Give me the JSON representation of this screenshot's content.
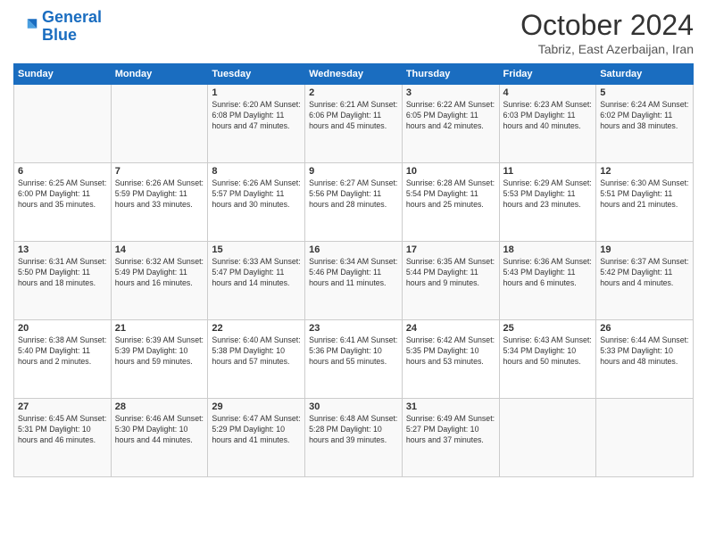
{
  "logo": {
    "line1": "General",
    "line2": "Blue"
  },
  "header": {
    "month": "October 2024",
    "location": "Tabriz, East Azerbaijan, Iran"
  },
  "weekdays": [
    "Sunday",
    "Monday",
    "Tuesday",
    "Wednesday",
    "Thursday",
    "Friday",
    "Saturday"
  ],
  "weeks": [
    [
      {
        "day": "",
        "info": ""
      },
      {
        "day": "",
        "info": ""
      },
      {
        "day": "1",
        "info": "Sunrise: 6:20 AM\nSunset: 6:08 PM\nDaylight: 11 hours and 47 minutes."
      },
      {
        "day": "2",
        "info": "Sunrise: 6:21 AM\nSunset: 6:06 PM\nDaylight: 11 hours and 45 minutes."
      },
      {
        "day": "3",
        "info": "Sunrise: 6:22 AM\nSunset: 6:05 PM\nDaylight: 11 hours and 42 minutes."
      },
      {
        "day": "4",
        "info": "Sunrise: 6:23 AM\nSunset: 6:03 PM\nDaylight: 11 hours and 40 minutes."
      },
      {
        "day": "5",
        "info": "Sunrise: 6:24 AM\nSunset: 6:02 PM\nDaylight: 11 hours and 38 minutes."
      }
    ],
    [
      {
        "day": "6",
        "info": "Sunrise: 6:25 AM\nSunset: 6:00 PM\nDaylight: 11 hours and 35 minutes."
      },
      {
        "day": "7",
        "info": "Sunrise: 6:26 AM\nSunset: 5:59 PM\nDaylight: 11 hours and 33 minutes."
      },
      {
        "day": "8",
        "info": "Sunrise: 6:26 AM\nSunset: 5:57 PM\nDaylight: 11 hours and 30 minutes."
      },
      {
        "day": "9",
        "info": "Sunrise: 6:27 AM\nSunset: 5:56 PM\nDaylight: 11 hours and 28 minutes."
      },
      {
        "day": "10",
        "info": "Sunrise: 6:28 AM\nSunset: 5:54 PM\nDaylight: 11 hours and 25 minutes."
      },
      {
        "day": "11",
        "info": "Sunrise: 6:29 AM\nSunset: 5:53 PM\nDaylight: 11 hours and 23 minutes."
      },
      {
        "day": "12",
        "info": "Sunrise: 6:30 AM\nSunset: 5:51 PM\nDaylight: 11 hours and 21 minutes."
      }
    ],
    [
      {
        "day": "13",
        "info": "Sunrise: 6:31 AM\nSunset: 5:50 PM\nDaylight: 11 hours and 18 minutes."
      },
      {
        "day": "14",
        "info": "Sunrise: 6:32 AM\nSunset: 5:49 PM\nDaylight: 11 hours and 16 minutes."
      },
      {
        "day": "15",
        "info": "Sunrise: 6:33 AM\nSunset: 5:47 PM\nDaylight: 11 hours and 14 minutes."
      },
      {
        "day": "16",
        "info": "Sunrise: 6:34 AM\nSunset: 5:46 PM\nDaylight: 11 hours and 11 minutes."
      },
      {
        "day": "17",
        "info": "Sunrise: 6:35 AM\nSunset: 5:44 PM\nDaylight: 11 hours and 9 minutes."
      },
      {
        "day": "18",
        "info": "Sunrise: 6:36 AM\nSunset: 5:43 PM\nDaylight: 11 hours and 6 minutes."
      },
      {
        "day": "19",
        "info": "Sunrise: 6:37 AM\nSunset: 5:42 PM\nDaylight: 11 hours and 4 minutes."
      }
    ],
    [
      {
        "day": "20",
        "info": "Sunrise: 6:38 AM\nSunset: 5:40 PM\nDaylight: 11 hours and 2 minutes."
      },
      {
        "day": "21",
        "info": "Sunrise: 6:39 AM\nSunset: 5:39 PM\nDaylight: 10 hours and 59 minutes."
      },
      {
        "day": "22",
        "info": "Sunrise: 6:40 AM\nSunset: 5:38 PM\nDaylight: 10 hours and 57 minutes."
      },
      {
        "day": "23",
        "info": "Sunrise: 6:41 AM\nSunset: 5:36 PM\nDaylight: 10 hours and 55 minutes."
      },
      {
        "day": "24",
        "info": "Sunrise: 6:42 AM\nSunset: 5:35 PM\nDaylight: 10 hours and 53 minutes."
      },
      {
        "day": "25",
        "info": "Sunrise: 6:43 AM\nSunset: 5:34 PM\nDaylight: 10 hours and 50 minutes."
      },
      {
        "day": "26",
        "info": "Sunrise: 6:44 AM\nSunset: 5:33 PM\nDaylight: 10 hours and 48 minutes."
      }
    ],
    [
      {
        "day": "27",
        "info": "Sunrise: 6:45 AM\nSunset: 5:31 PM\nDaylight: 10 hours and 46 minutes."
      },
      {
        "day": "28",
        "info": "Sunrise: 6:46 AM\nSunset: 5:30 PM\nDaylight: 10 hours and 44 minutes."
      },
      {
        "day": "29",
        "info": "Sunrise: 6:47 AM\nSunset: 5:29 PM\nDaylight: 10 hours and 41 minutes."
      },
      {
        "day": "30",
        "info": "Sunrise: 6:48 AM\nSunset: 5:28 PM\nDaylight: 10 hours and 39 minutes."
      },
      {
        "day": "31",
        "info": "Sunrise: 6:49 AM\nSunset: 5:27 PM\nDaylight: 10 hours and 37 minutes."
      },
      {
        "day": "",
        "info": ""
      },
      {
        "day": "",
        "info": ""
      }
    ]
  ]
}
